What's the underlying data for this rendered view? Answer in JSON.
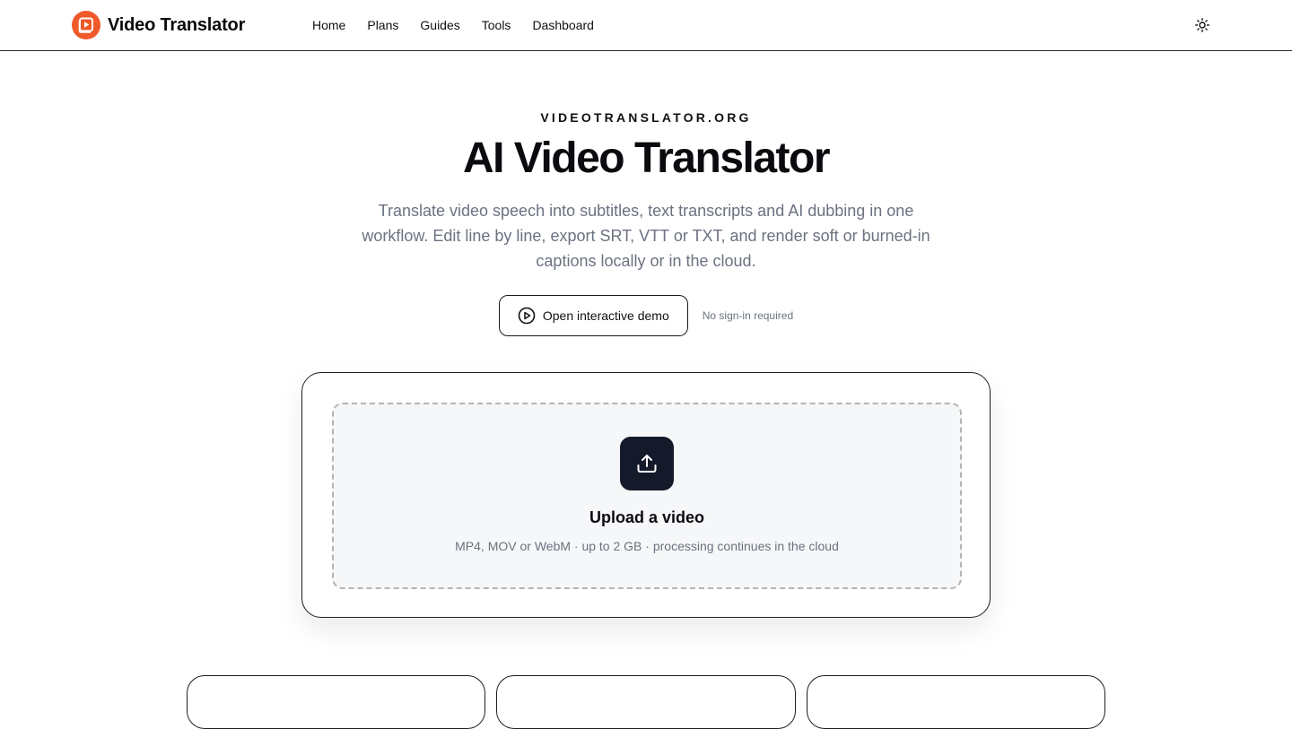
{
  "header": {
    "brand_name": "Video Translator",
    "nav": [
      "Home",
      "Plans",
      "Guides",
      "Tools",
      "Dashboard"
    ],
    "theme_icon": "sun-icon"
  },
  "hero": {
    "eyebrow": "VIDEOTRANSLATOR.ORG",
    "title": "AI Video Translator",
    "subtitle": "Translate video speech into subtitles, text transcripts and AI dubbing in one workflow. Edit line by line, export SRT, VTT or TXT, and render soft or burned-in captions locally or in the cloud.",
    "demo_button": "Open interactive demo",
    "no_signin": "No sign-in required"
  },
  "upload": {
    "title": "Upload a video",
    "description": "MP4, MOV or WebM · up to 2 GB · processing continues in the cloud"
  },
  "colors": {
    "brand": "#ef5a2a",
    "upload_icon_bg": "#151a2b",
    "muted_text": "#6b7280"
  }
}
